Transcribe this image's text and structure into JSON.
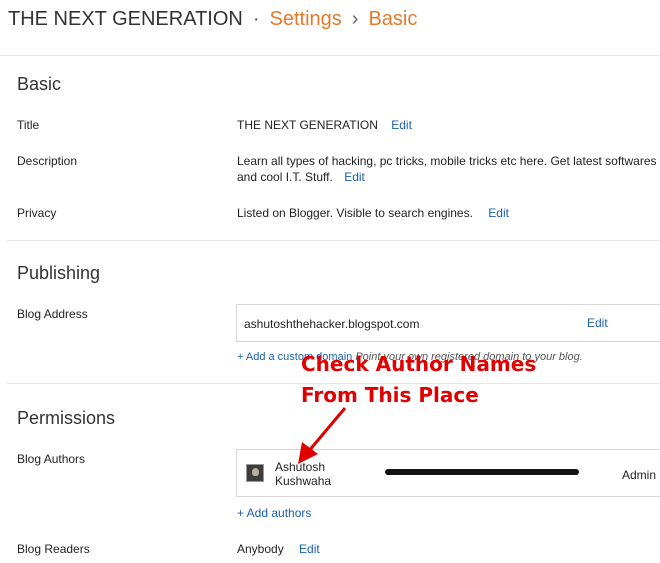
{
  "breadcrumb": {
    "blog_name": "THE NEXT GENERATION",
    "separator": "·",
    "settings": "Settings",
    "arrow": "›",
    "current": "Basic"
  },
  "sections": {
    "basic": {
      "title": "Basic",
      "title_label": "Title",
      "title_value": "THE NEXT GENERATION",
      "title_edit": "Edit",
      "description_label": "Description",
      "description_value": "Learn all types of hacking, pc tricks, mobile tricks etc here. Get latest softwares and cool I.T. Stuff.",
      "description_edit": "Edit",
      "privacy_label": "Privacy",
      "privacy_value": "Listed on Blogger. Visible to search engines.",
      "privacy_edit": "Edit"
    },
    "publishing": {
      "title": "Publishing",
      "address_label": "Blog Address",
      "address_value": "ashutoshthehacker.blogspot.com",
      "address_edit": "Edit",
      "domain_link": "+ Add a custom domain",
      "domain_hint": "Point your own registered domain to your blog."
    },
    "permissions": {
      "title": "Permissions",
      "authors_label": "Blog Authors",
      "author": {
        "name": "Ashutosh Kushwaha",
        "role": "Admin"
      },
      "add_authors": "+ Add authors",
      "readers_label": "Blog Readers",
      "readers_value": "Anybody",
      "readers_edit": "Edit"
    }
  },
  "annotation": {
    "line1": "Check Author Names",
    "line2": "From This Place",
    "color": "#e00000"
  },
  "colors": {
    "accent": "#e57a2c",
    "link": "#1a5fad"
  }
}
